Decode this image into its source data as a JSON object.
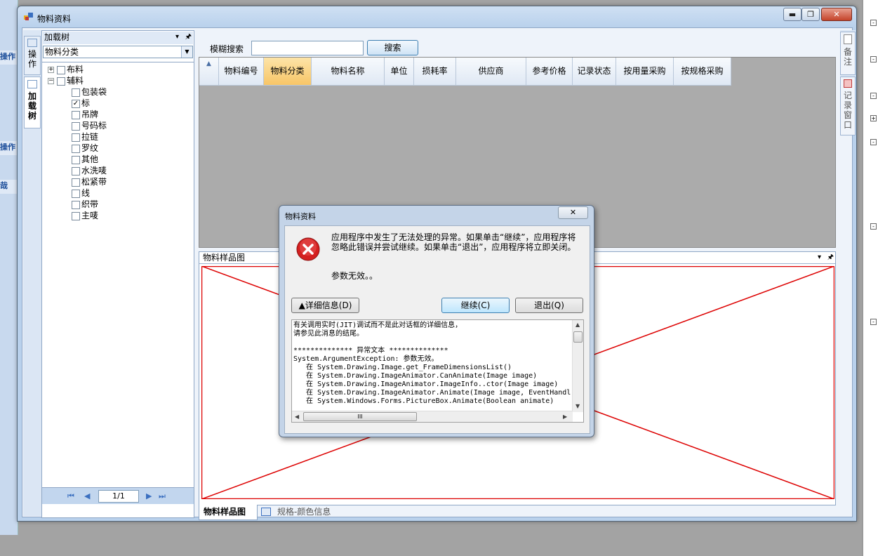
{
  "background_app": {
    "left_labels": [
      "操作",
      "操作",
      "哉"
    ],
    "right_markers": [
      "-",
      "-",
      "-",
      "+",
      "-",
      "-",
      "-"
    ]
  },
  "window": {
    "title": "物料资料",
    "min_glyph": "▬",
    "max_glyph": "❐",
    "close_glyph": "✕"
  },
  "left_tabs": [
    {
      "label": "操作"
    },
    {
      "label": "加载树"
    }
  ],
  "tree_panel": {
    "header_label": "加载树",
    "header_arrow": "▾",
    "pin": "🖈",
    "combo_value": "物料分类",
    "combo_arrow": "▼",
    "nodes": [
      {
        "label": "布料",
        "expander": "+",
        "checked": false,
        "level": 0
      },
      {
        "label": "辅料",
        "expander": "−",
        "checked": false,
        "level": 0
      },
      {
        "label": "包装袋",
        "checked": false,
        "level": 1
      },
      {
        "label": "标",
        "checked": true,
        "level": 1
      },
      {
        "label": "吊牌",
        "checked": false,
        "level": 1
      },
      {
        "label": "号码标",
        "checked": false,
        "level": 1
      },
      {
        "label": "拉链",
        "checked": false,
        "level": 1
      },
      {
        "label": "罗纹",
        "checked": false,
        "level": 1
      },
      {
        "label": "其他",
        "checked": false,
        "level": 1
      },
      {
        "label": "水洗唛",
        "checked": false,
        "level": 1
      },
      {
        "label": "松紧带",
        "checked": false,
        "level": 1
      },
      {
        "label": "线",
        "checked": false,
        "level": 1
      },
      {
        "label": "织带",
        "checked": false,
        "level": 1
      },
      {
        "label": "主唛",
        "checked": false,
        "level": 1
      }
    ],
    "check_mark": "✓",
    "pager": {
      "first": "⏮",
      "prev": "◀",
      "page": "1/1",
      "next": "▶",
      "last": "⏭"
    }
  },
  "search": {
    "label": "模糊搜索",
    "value": "",
    "button": "搜索"
  },
  "grid": {
    "corner": "▲",
    "columns": [
      "物料编号",
      "物料分类",
      "物料名称",
      "单位",
      "损耗率",
      "供应商",
      "参考价格",
      "记录状态",
      "按用量采购",
      "按规格采购"
    ],
    "selected_column": "物料分类"
  },
  "picture_panel": {
    "title": "物料样品图",
    "header_arrow": "▾",
    "pin": "🖈"
  },
  "bottom_tabs": [
    {
      "label": "物料样品图"
    },
    {
      "label": "规格-颜色信息"
    }
  ],
  "right_tabs": [
    {
      "label": "备注"
    },
    {
      "label": "记录窗口"
    }
  ],
  "dialog": {
    "title": "物料资料",
    "close_glyph": "✕",
    "message": "应用程序中发生了无法处理的异常。如果单击“继续”，应用程序将忽略此错误并尝试继续。如果单击“退出”，应用程序将立即关闭。",
    "param_message": "参数无效。。",
    "details_button": "▲详细信息(D)",
    "continue_button": "继续(C)",
    "quit_button": "退出(Q)",
    "detail_lines": [
      "有关调用实时(JIT)调试而不是此对话框的详细信息，",
      "请参见此消息的结尾。",
      "",
      "************** 异常文本 **************",
      "System.ArgumentException: 参数无效。",
      "   在 System.Drawing.Image.get_FrameDimensionsList()",
      "   在 System.Drawing.ImageAnimator.CanAnimate(Image image)",
      "   在 System.Drawing.ImageAnimator.ImageInfo..ctor(Image image)",
      "   在 System.Drawing.ImageAnimator.Animate(Image image, EventHandl",
      "   在 System.Windows.Forms.PictureBox.Animate(Boolean animate)"
    ],
    "scroll_up": "▲",
    "scroll_down": "▼",
    "scroll_left": "◀",
    "scroll_right": "▶",
    "scroll_grip": "III"
  },
  "colors": {
    "placeholder_x": "#dd0000",
    "selected_header": "#f7c567",
    "error_red": "#d42020"
  }
}
